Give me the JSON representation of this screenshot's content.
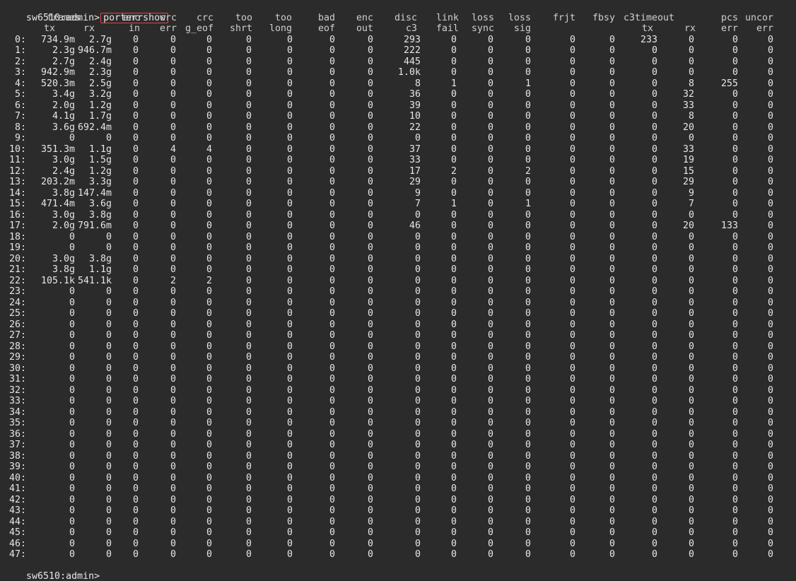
{
  "terminal": {
    "prompt": "sw6510:admin>",
    "command": "porterrshow",
    "bottom_prompt": "sw6510:admin> "
  },
  "header": {
    "row1": [
      "frames",
      "enc",
      "crc",
      "crc",
      "too",
      "too",
      "bad",
      "enc",
      "disc",
      "link",
      "loss",
      "loss",
      "frjt",
      "fbsy",
      "c3timeout",
      "pcs",
      "uncor"
    ],
    "row2": [
      "tx",
      "rx",
      "in",
      "err",
      "g_eof",
      "shrt",
      "long",
      "eof",
      "out",
      "c3",
      "fail",
      "sync",
      "sig",
      "tx",
      "rx",
      "err",
      "err"
    ]
  },
  "rows": [
    [
      "0:",
      "734.9m",
      "2.7g",
      "0",
      "0",
      "0",
      "0",
      "0",
      "0",
      "0",
      "293",
      "0",
      "0",
      "0",
      "0",
      "0",
      "233",
      "0",
      "0",
      "0"
    ],
    [
      "1:",
      "2.3g",
      "946.7m",
      "0",
      "0",
      "0",
      "0",
      "0",
      "0",
      "0",
      "222",
      "0",
      "0",
      "0",
      "0",
      "0",
      "0",
      "0",
      "0",
      "0"
    ],
    [
      "2:",
      "2.7g",
      "2.4g",
      "0",
      "0",
      "0",
      "0",
      "0",
      "0",
      "0",
      "445",
      "0",
      "0",
      "0",
      "0",
      "0",
      "0",
      "0",
      "0",
      "0"
    ],
    [
      "3:",
      "942.9m",
      "2.3g",
      "0",
      "0",
      "0",
      "0",
      "0",
      "0",
      "0",
      "1.0k",
      "0",
      "0",
      "0",
      "0",
      "0",
      "0",
      "0",
      "0",
      "0"
    ],
    [
      "4:",
      "520.3m",
      "2.5g",
      "0",
      "0",
      "0",
      "0",
      "0",
      "0",
      "0",
      "8",
      "1",
      "0",
      "1",
      "0",
      "0",
      "0",
      "8",
      "255",
      "0"
    ],
    [
      "5:",
      "3.4g",
      "3.2g",
      "0",
      "0",
      "0",
      "0",
      "0",
      "0",
      "0",
      "36",
      "0",
      "0",
      "0",
      "0",
      "0",
      "0",
      "32",
      "0",
      "0"
    ],
    [
      "6:",
      "2.0g",
      "1.2g",
      "0",
      "0",
      "0",
      "0",
      "0",
      "0",
      "0",
      "39",
      "0",
      "0",
      "0",
      "0",
      "0",
      "0",
      "33",
      "0",
      "0"
    ],
    [
      "7:",
      "4.1g",
      "1.7g",
      "0",
      "0",
      "0",
      "0",
      "0",
      "0",
      "0",
      "10",
      "0",
      "0",
      "0",
      "0",
      "0",
      "0",
      "8",
      "0",
      "0"
    ],
    [
      "8:",
      "3.6g",
      "692.4m",
      "0",
      "0",
      "0",
      "0",
      "0",
      "0",
      "0",
      "22",
      "0",
      "0",
      "0",
      "0",
      "0",
      "0",
      "20",
      "0",
      "0"
    ],
    [
      "9:",
      "0",
      "0",
      "0",
      "0",
      "0",
      "0",
      "0",
      "0",
      "0",
      "0",
      "0",
      "0",
      "0",
      "0",
      "0",
      "0",
      "0",
      "0",
      "0"
    ],
    [
      "10:",
      "351.3m",
      "1.1g",
      "0",
      "4",
      "4",
      "0",
      "0",
      "0",
      "0",
      "37",
      "0",
      "0",
      "0",
      "0",
      "0",
      "0",
      "33",
      "0",
      "0"
    ],
    [
      "11:",
      "3.0g",
      "1.5g",
      "0",
      "0",
      "0",
      "0",
      "0",
      "0",
      "0",
      "33",
      "0",
      "0",
      "0",
      "0",
      "0",
      "0",
      "19",
      "0",
      "0"
    ],
    [
      "12:",
      "2.4g",
      "1.2g",
      "0",
      "0",
      "0",
      "0",
      "0",
      "0",
      "0",
      "17",
      "2",
      "0",
      "2",
      "0",
      "0",
      "0",
      "15",
      "0",
      "0"
    ],
    [
      "13:",
      "203.2m",
      "3.3g",
      "0",
      "0",
      "0",
      "0",
      "0",
      "0",
      "0",
      "29",
      "0",
      "0",
      "0",
      "0",
      "0",
      "0",
      "29",
      "0",
      "0"
    ],
    [
      "14:",
      "3.8g",
      "147.4m",
      "0",
      "0",
      "0",
      "0",
      "0",
      "0",
      "0",
      "9",
      "0",
      "0",
      "0",
      "0",
      "0",
      "0",
      "9",
      "0",
      "0"
    ],
    [
      "15:",
      "471.4m",
      "3.6g",
      "0",
      "0",
      "0",
      "0",
      "0",
      "0",
      "0",
      "7",
      "1",
      "0",
      "1",
      "0",
      "0",
      "0",
      "7",
      "0",
      "0"
    ],
    [
      "16:",
      "3.0g",
      "3.8g",
      "0",
      "0",
      "0",
      "0",
      "0",
      "0",
      "0",
      "0",
      "0",
      "0",
      "0",
      "0",
      "0",
      "0",
      "0",
      "0",
      "0"
    ],
    [
      "17:",
      "2.0g",
      "791.6m",
      "0",
      "0",
      "0",
      "0",
      "0",
      "0",
      "0",
      "46",
      "0",
      "0",
      "0",
      "0",
      "0",
      "0",
      "20",
      "133",
      "0"
    ],
    [
      "18:",
      "0",
      "0",
      "0",
      "0",
      "0",
      "0",
      "0",
      "0",
      "0",
      "0",
      "0",
      "0",
      "0",
      "0",
      "0",
      "0",
      "0",
      "0",
      "0"
    ],
    [
      "19:",
      "0",
      "0",
      "0",
      "0",
      "0",
      "0",
      "0",
      "0",
      "0",
      "0",
      "0",
      "0",
      "0",
      "0",
      "0",
      "0",
      "0",
      "0",
      "0"
    ],
    [
      "20:",
      "3.0g",
      "3.8g",
      "0",
      "0",
      "0",
      "0",
      "0",
      "0",
      "0",
      "0",
      "0",
      "0",
      "0",
      "0",
      "0",
      "0",
      "0",
      "0",
      "0"
    ],
    [
      "21:",
      "3.8g",
      "1.1g",
      "0",
      "0",
      "0",
      "0",
      "0",
      "0",
      "0",
      "0",
      "0",
      "0",
      "0",
      "0",
      "0",
      "0",
      "0",
      "0",
      "0"
    ],
    [
      "22:",
      "105.1k",
      "541.1k",
      "0",
      "2",
      "2",
      "0",
      "0",
      "0",
      "0",
      "0",
      "0",
      "0",
      "0",
      "0",
      "0",
      "0",
      "0",
      "0",
      "0"
    ],
    [
      "23:",
      "0",
      "0",
      "0",
      "0",
      "0",
      "0",
      "0",
      "0",
      "0",
      "0",
      "0",
      "0",
      "0",
      "0",
      "0",
      "0",
      "0",
      "0",
      "0"
    ],
    [
      "24:",
      "0",
      "0",
      "0",
      "0",
      "0",
      "0",
      "0",
      "0",
      "0",
      "0",
      "0",
      "0",
      "0",
      "0",
      "0",
      "0",
      "0",
      "0",
      "0"
    ],
    [
      "25:",
      "0",
      "0",
      "0",
      "0",
      "0",
      "0",
      "0",
      "0",
      "0",
      "0",
      "0",
      "0",
      "0",
      "0",
      "0",
      "0",
      "0",
      "0",
      "0"
    ],
    [
      "26:",
      "0",
      "0",
      "0",
      "0",
      "0",
      "0",
      "0",
      "0",
      "0",
      "0",
      "0",
      "0",
      "0",
      "0",
      "0",
      "0",
      "0",
      "0",
      "0"
    ],
    [
      "27:",
      "0",
      "0",
      "0",
      "0",
      "0",
      "0",
      "0",
      "0",
      "0",
      "0",
      "0",
      "0",
      "0",
      "0",
      "0",
      "0",
      "0",
      "0",
      "0"
    ],
    [
      "28:",
      "0",
      "0",
      "0",
      "0",
      "0",
      "0",
      "0",
      "0",
      "0",
      "0",
      "0",
      "0",
      "0",
      "0",
      "0",
      "0",
      "0",
      "0",
      "0"
    ],
    [
      "29:",
      "0",
      "0",
      "0",
      "0",
      "0",
      "0",
      "0",
      "0",
      "0",
      "0",
      "0",
      "0",
      "0",
      "0",
      "0",
      "0",
      "0",
      "0",
      "0"
    ],
    [
      "30:",
      "0",
      "0",
      "0",
      "0",
      "0",
      "0",
      "0",
      "0",
      "0",
      "0",
      "0",
      "0",
      "0",
      "0",
      "0",
      "0",
      "0",
      "0",
      "0"
    ],
    [
      "31:",
      "0",
      "0",
      "0",
      "0",
      "0",
      "0",
      "0",
      "0",
      "0",
      "0",
      "0",
      "0",
      "0",
      "0",
      "0",
      "0",
      "0",
      "0",
      "0"
    ],
    [
      "32:",
      "0",
      "0",
      "0",
      "0",
      "0",
      "0",
      "0",
      "0",
      "0",
      "0",
      "0",
      "0",
      "0",
      "0",
      "0",
      "0",
      "0",
      "0",
      "0"
    ],
    [
      "33:",
      "0",
      "0",
      "0",
      "0",
      "0",
      "0",
      "0",
      "0",
      "0",
      "0",
      "0",
      "0",
      "0",
      "0",
      "0",
      "0",
      "0",
      "0",
      "0"
    ],
    [
      "34:",
      "0",
      "0",
      "0",
      "0",
      "0",
      "0",
      "0",
      "0",
      "0",
      "0",
      "0",
      "0",
      "0",
      "0",
      "0",
      "0",
      "0",
      "0",
      "0"
    ],
    [
      "35:",
      "0",
      "0",
      "0",
      "0",
      "0",
      "0",
      "0",
      "0",
      "0",
      "0",
      "0",
      "0",
      "0",
      "0",
      "0",
      "0",
      "0",
      "0",
      "0"
    ],
    [
      "36:",
      "0",
      "0",
      "0",
      "0",
      "0",
      "0",
      "0",
      "0",
      "0",
      "0",
      "0",
      "0",
      "0",
      "0",
      "0",
      "0",
      "0",
      "0",
      "0"
    ],
    [
      "37:",
      "0",
      "0",
      "0",
      "0",
      "0",
      "0",
      "0",
      "0",
      "0",
      "0",
      "0",
      "0",
      "0",
      "0",
      "0",
      "0",
      "0",
      "0",
      "0"
    ],
    [
      "38:",
      "0",
      "0",
      "0",
      "0",
      "0",
      "0",
      "0",
      "0",
      "0",
      "0",
      "0",
      "0",
      "0",
      "0",
      "0",
      "0",
      "0",
      "0",
      "0"
    ],
    [
      "39:",
      "0",
      "0",
      "0",
      "0",
      "0",
      "0",
      "0",
      "0",
      "0",
      "0",
      "0",
      "0",
      "0",
      "0",
      "0",
      "0",
      "0",
      "0",
      "0"
    ],
    [
      "40:",
      "0",
      "0",
      "0",
      "0",
      "0",
      "0",
      "0",
      "0",
      "0",
      "0",
      "0",
      "0",
      "0",
      "0",
      "0",
      "0",
      "0",
      "0",
      "0"
    ],
    [
      "41:",
      "0",
      "0",
      "0",
      "0",
      "0",
      "0",
      "0",
      "0",
      "0",
      "0",
      "0",
      "0",
      "0",
      "0",
      "0",
      "0",
      "0",
      "0",
      "0"
    ],
    [
      "42:",
      "0",
      "0",
      "0",
      "0",
      "0",
      "0",
      "0",
      "0",
      "0",
      "0",
      "0",
      "0",
      "0",
      "0",
      "0",
      "0",
      "0",
      "0",
      "0"
    ],
    [
      "43:",
      "0",
      "0",
      "0",
      "0",
      "0",
      "0",
      "0",
      "0",
      "0",
      "0",
      "0",
      "0",
      "0",
      "0",
      "0",
      "0",
      "0",
      "0",
      "0"
    ],
    [
      "44:",
      "0",
      "0",
      "0",
      "0",
      "0",
      "0",
      "0",
      "0",
      "0",
      "0",
      "0",
      "0",
      "0",
      "0",
      "0",
      "0",
      "0",
      "0",
      "0"
    ],
    [
      "45:",
      "0",
      "0",
      "0",
      "0",
      "0",
      "0",
      "0",
      "0",
      "0",
      "0",
      "0",
      "0",
      "0",
      "0",
      "0",
      "0",
      "0",
      "0",
      "0"
    ],
    [
      "46:",
      "0",
      "0",
      "0",
      "0",
      "0",
      "0",
      "0",
      "0",
      "0",
      "0",
      "0",
      "0",
      "0",
      "0",
      "0",
      "0",
      "0",
      "0",
      "0"
    ],
    [
      "47:",
      "0",
      "0",
      "0",
      "0",
      "0",
      "0",
      "0",
      "0",
      "0",
      "0",
      "0",
      "0",
      "0",
      "0",
      "0",
      "0",
      "0",
      "0",
      "0"
    ]
  ],
  "colors": {
    "background": "#2b2b2b",
    "text": "#e6e6e6",
    "command_highlight_border": "#e04848"
  }
}
